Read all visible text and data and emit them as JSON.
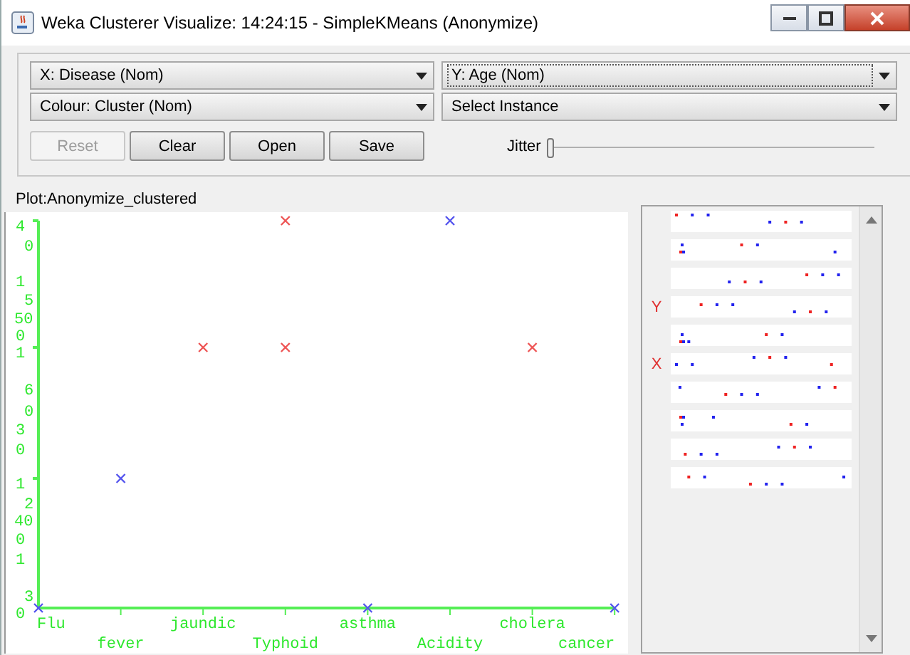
{
  "window": {
    "title": "Weka Clusterer Visualize: 14:24:15 - SimpleKMeans (Anonymize)"
  },
  "selectors": [
    {
      "label": "X: Disease (Nom)",
      "focused": false
    },
    {
      "label": "Y: Age (Nom)",
      "focused": true
    },
    {
      "label": "Colour: Cluster (Nom)",
      "focused": false
    },
    {
      "label": "Select Instance",
      "focused": false
    }
  ],
  "buttons": [
    {
      "label": "Reset",
      "disabled": true
    },
    {
      "label": "Clear",
      "disabled": false
    },
    {
      "label": "Open",
      "disabled": false
    },
    {
      "label": "Save",
      "disabled": false
    }
  ],
  "jitter": {
    "label": "Jitter",
    "level": 0
  },
  "plot": {
    "title": "Plot:Anonymize_clustered",
    "y_axis_labels": [
      "4",
      "0",
      "1",
      "5",
      "50",
      "0",
      "1",
      "6",
      "0",
      "3",
      "0",
      "1",
      "2",
      "40",
      "0",
      "1",
      "3",
      "0"
    ],
    "x_axis_labels": [
      "Flu",
      "fever",
      "jaundic",
      "Typhoid",
      "asthma",
      "Acidity",
      "cholera",
      "cancer"
    ]
  },
  "attribute_rows": [
    {
      "kind": "plain"
    },
    {
      "kind": "plain"
    },
    {
      "kind": "plain"
    },
    {
      "kind": "marked",
      "marker": "Y"
    },
    {
      "kind": "plain"
    },
    {
      "kind": "marked",
      "marker": "X"
    },
    {
      "kind": "plain"
    },
    {
      "kind": "plain"
    },
    {
      "kind": "plain"
    },
    {
      "kind": "plain"
    }
  ]
}
